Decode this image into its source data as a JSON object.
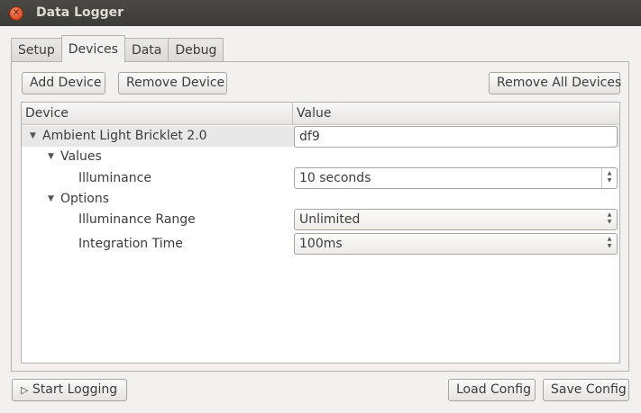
{
  "window": {
    "title": "Data Logger"
  },
  "tabs": [
    {
      "label": "Setup"
    },
    {
      "label": "Devices"
    },
    {
      "label": "Data"
    },
    {
      "label": "Debug"
    }
  ],
  "toolbar": {
    "add_device": "Add Device",
    "remove_device": "Remove Device",
    "remove_all": "Remove All Devices"
  },
  "tree": {
    "columns": [
      "Device",
      "Value"
    ],
    "device": {
      "name": "Ambient Light Bricklet 2.0",
      "value": "df9"
    },
    "values_group": "Values",
    "illuminance": {
      "label": "Illuminance",
      "value": "10 seconds"
    },
    "options_group": "Options",
    "illuminance_range": {
      "label": "Illuminance Range",
      "value": "Unlimited"
    },
    "integration_time": {
      "label": "Integration Time",
      "value": "100ms"
    }
  },
  "footer": {
    "start_logging": "Start Logging",
    "load_config": "Load Config",
    "save_config": "Save Config"
  }
}
